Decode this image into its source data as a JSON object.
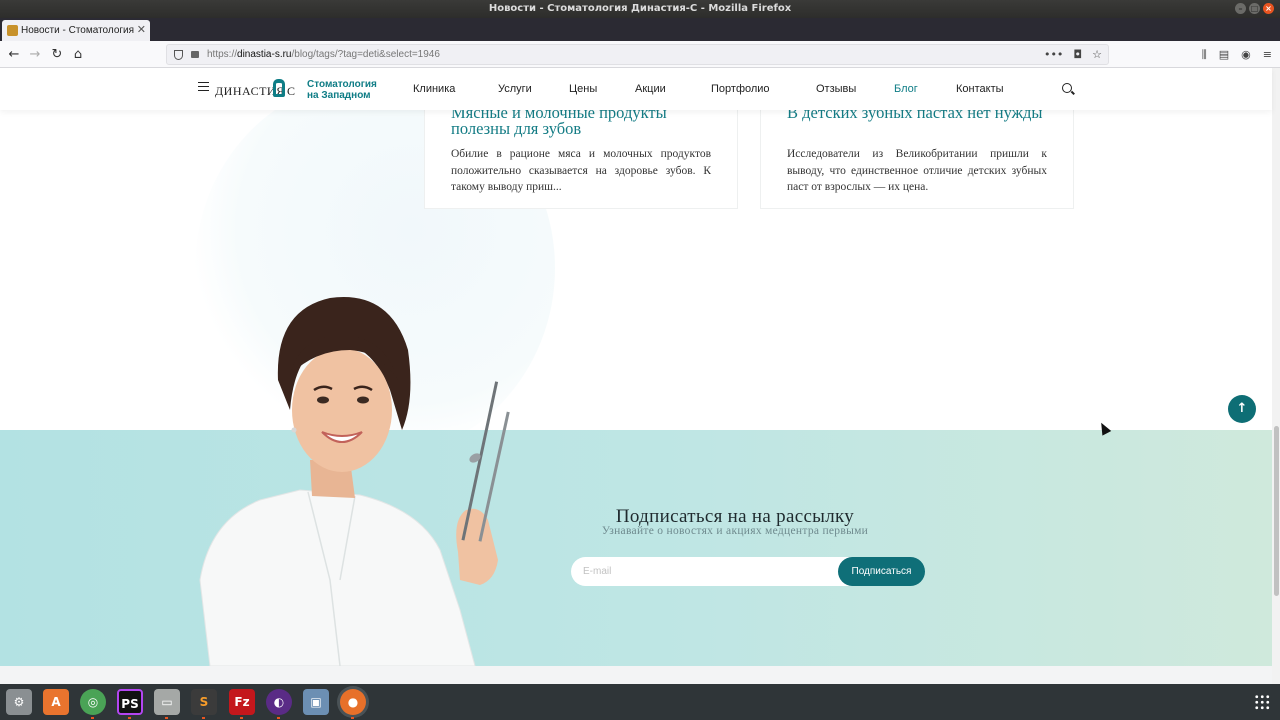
{
  "window": {
    "title": "Новости - Стоматология Династия-С - Mozilla Firefox"
  },
  "browser": {
    "tab_title": "Новости - Стоматология",
    "url_domain": "dinastia-s.ru",
    "url_prefix": "https://",
    "url_path": "/blog/tags/?tag=deti&select=1946"
  },
  "site": {
    "logo_name": "ДИНАСТИЯ",
    "logo_letter": "С",
    "logo_sub_line1": "Стоматология",
    "logo_sub_line2": "на Западном",
    "menu": [
      "Клиника",
      "Услуги",
      "Цены",
      "Акции",
      "Портфолио",
      "Отзывы",
      "Блог",
      "Контакты"
    ],
    "active_menu": "Блог"
  },
  "cards": [
    {
      "title": "Мясные и молочные продукты полезны для зубов",
      "text": "Обилие в рационе мяса и молочных продуктов положительно сказывается на здоровье зубов. К такому выводу приш..."
    },
    {
      "title": "В детских зубных пастах нет нужды",
      "text": "Исследователи из Великобритании пришли к выводу, что единственное отличие детских зубных паст от взрослых — их цена."
    }
  ],
  "subscribe": {
    "title": "Подписаться на на рассылку",
    "subtitle": "Узнавайте о новостях и акциях медцентра первыми",
    "email_placeholder": "E-mail",
    "button": "Подписаться"
  },
  "colors": {
    "accent": "#0f7d86",
    "button": "#0f6f78",
    "band_start": "#b3e2e3",
    "band_end": "#cfe9dc"
  },
  "taskbar": {
    "apps": [
      "settings-icon",
      "software-center-icon",
      "chrome-icon",
      "phpstorm-icon",
      "files-icon",
      "sublime-icon",
      "filezilla-icon",
      "tor-icon",
      "screenshot-icon",
      "firefox-icon"
    ]
  }
}
